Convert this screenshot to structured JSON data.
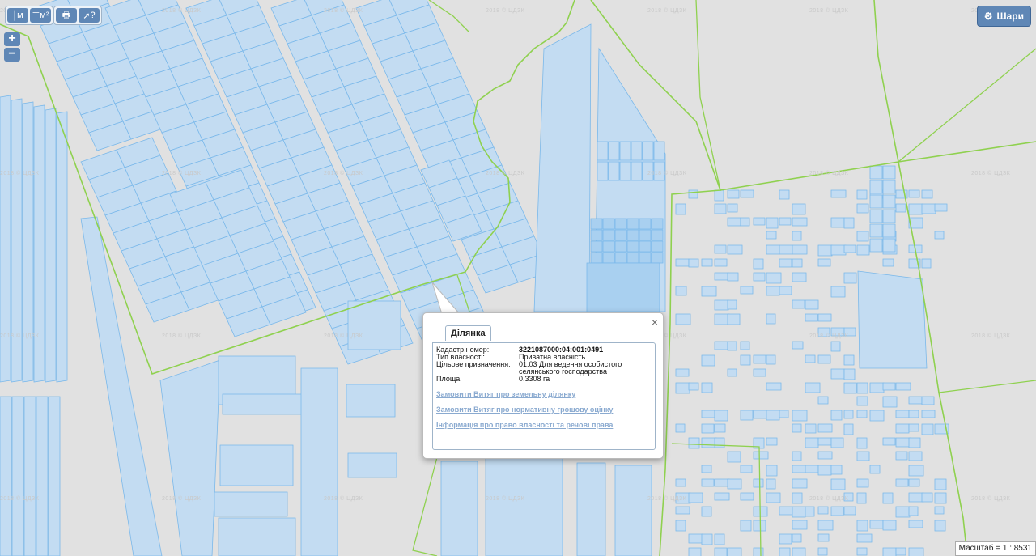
{
  "toolbar": {
    "measure_length_label": "м",
    "measure_area_label": "м²",
    "print_label": "🖶",
    "info_label": "?"
  },
  "zoom": {
    "in_label": "+",
    "out_label": "−"
  },
  "layers_button": {
    "label": "Шари"
  },
  "watermark": "2018 © ЦДЗК",
  "popup": {
    "tab_label": "Ділянка",
    "fields": [
      {
        "key": "Кадастр.номер:",
        "value": "3221087000:04:001:0491",
        "bold": true
      },
      {
        "key": "Тип власності:",
        "value": "Приватна власність",
        "bold": false
      },
      {
        "key": "Цільове призначення:",
        "value": "01.03 Для ведення особистого селянського господарства",
        "bold": false
      },
      {
        "key": "Площа:",
        "value": "0.3308 га",
        "bold": false
      }
    ],
    "links": [
      "Замовити Витяг про земельну ділянку",
      "Замовити Витяг про нормативну грошову оцінку",
      "Інформація про право власності та речові права"
    ],
    "close_label": "×"
  },
  "scale": {
    "label": "Масштаб = 1 : 8531"
  },
  "colors": {
    "parcel_fill": "#c3dcf2",
    "parcel_stroke": "#7ab8ea",
    "boundary": "#8fd14f",
    "road": "#e1e1e1"
  }
}
